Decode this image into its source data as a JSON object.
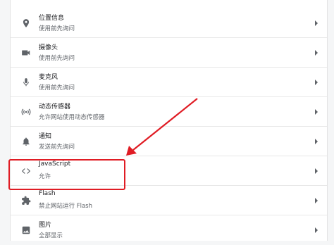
{
  "settings": {
    "items": [
      {
        "icon": "location-pin-icon",
        "title": "位置信息",
        "subtitle": "使用前先询问"
      },
      {
        "icon": "camera-icon",
        "title": "摄像头",
        "subtitle": "使用前先询问"
      },
      {
        "icon": "microphone-icon",
        "title": "麦克风",
        "subtitle": "使用前先询问"
      },
      {
        "icon": "sensors-icon",
        "title": "动态传感器",
        "subtitle": "允许网站使用动态传感器"
      },
      {
        "icon": "bell-icon",
        "title": "通知",
        "subtitle": "发送前先询问"
      },
      {
        "icon": "code-icon",
        "title": "JavaScript",
        "subtitle": "允许"
      },
      {
        "icon": "puzzle-icon",
        "title": "Flash",
        "subtitle": "禁止网站运行 Flash"
      },
      {
        "icon": "image-icon",
        "title": "图片",
        "subtitle": "全部显示"
      }
    ]
  },
  "annotation": {
    "color": "#e01c24",
    "highlighted_item": "JavaScript"
  }
}
